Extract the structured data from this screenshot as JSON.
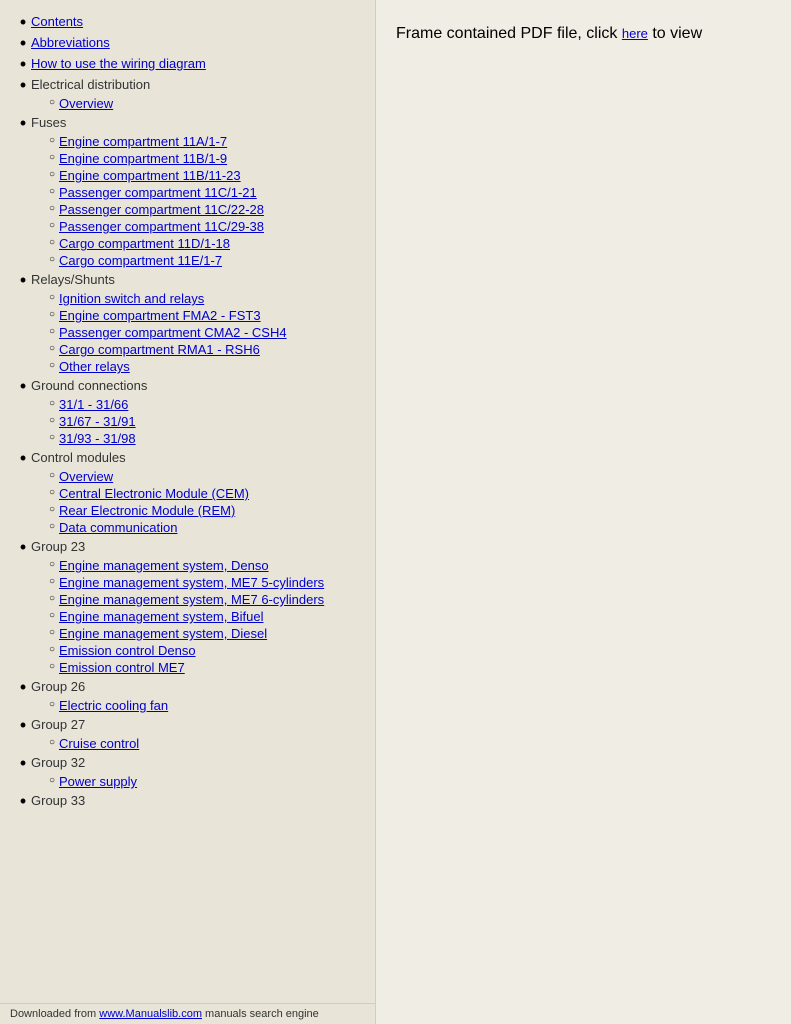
{
  "sidebar": {
    "top_level_items": [
      {
        "label": "Contents",
        "is_link": true,
        "href": "#",
        "children": []
      },
      {
        "label": "Abbreviations",
        "is_link": true,
        "href": "#",
        "children": []
      },
      {
        "label": "How to use the wiring diagram",
        "is_link": true,
        "href": "#",
        "children": []
      },
      {
        "label": "Electrical distribution",
        "is_link": false,
        "children": [
          {
            "label": "Overview",
            "href": "#"
          }
        ]
      },
      {
        "label": "Fuses",
        "is_link": false,
        "children": [
          {
            "label": "Engine compartment 11A/1-7",
            "href": "#"
          },
          {
            "label": "Engine compartment 11B/1-9",
            "href": "#"
          },
          {
            "label": "Engine compartment 11B/11-23",
            "href": "#"
          },
          {
            "label": "Passenger compartment 11C/1-21",
            "href": "#"
          },
          {
            "label": "Passenger compartment 11C/22-28",
            "href": "#"
          },
          {
            "label": "Passenger compartment 11C/29-38",
            "href": "#"
          },
          {
            "label": "Cargo compartment 11D/1-18",
            "href": "#"
          },
          {
            "label": "Cargo compartment 11E/1-7",
            "href": "#"
          }
        ]
      },
      {
        "label": "Relays/Shunts",
        "is_link": false,
        "children": [
          {
            "label": "Ignition switch and relays",
            "href": "#"
          },
          {
            "label": "Engine compartment FMA2 - FST3",
            "href": "#"
          },
          {
            "label": "Passenger compartment CMA2 - CSH4",
            "href": "#"
          },
          {
            "label": "Cargo compartment RMA1 - RSH6",
            "href": "#"
          },
          {
            "label": "Other relays",
            "href": "#"
          }
        ]
      },
      {
        "label": "Ground connections",
        "is_link": false,
        "children": [
          {
            "label": "31/1 - 31/66",
            "href": "#"
          },
          {
            "label": "31/67 - 31/91",
            "href": "#"
          },
          {
            "label": "31/93 - 31/98",
            "href": "#"
          }
        ]
      },
      {
        "label": "Control modules",
        "is_link": false,
        "children": [
          {
            "label": "Overview",
            "href": "#"
          },
          {
            "label": "Central Electronic Module (CEM)",
            "href": "#"
          },
          {
            "label": "Rear Electronic Module (REM)",
            "href": "#"
          },
          {
            "label": "Data communication",
            "href": "#"
          }
        ]
      },
      {
        "label": "Group 23",
        "is_link": false,
        "children": [
          {
            "label": "Engine management system, Denso",
            "href": "#"
          },
          {
            "label": "Engine management system, ME7 5-cylinders",
            "href": "#"
          },
          {
            "label": "Engine management system, ME7 6-cylinders",
            "href": "#"
          },
          {
            "label": "Engine management system, Bifuel",
            "href": "#"
          },
          {
            "label": "Engine management system, Diesel",
            "href": "#"
          },
          {
            "label": "Emission control Denso",
            "href": "#"
          },
          {
            "label": "Emission control ME7",
            "href": "#"
          }
        ]
      },
      {
        "label": "Group 26",
        "is_link": false,
        "children": [
          {
            "label": "Electric cooling fan",
            "href": "#"
          }
        ]
      },
      {
        "label": "Group 27",
        "is_link": false,
        "children": [
          {
            "label": "Cruise control",
            "href": "#"
          }
        ]
      },
      {
        "label": "Group 32",
        "is_link": false,
        "children": [
          {
            "label": "Power supply",
            "href": "#"
          }
        ]
      },
      {
        "label": "Group 33",
        "is_link": false,
        "children": []
      }
    ]
  },
  "main": {
    "frame_text": "Frame contained PDF file, click ",
    "frame_link_label": "here",
    "frame_text_after": " to view"
  },
  "footer": {
    "prefix": "Downloaded from ",
    "link_label": "www.Manualslib.com",
    "suffix": " manuals search engine"
  }
}
